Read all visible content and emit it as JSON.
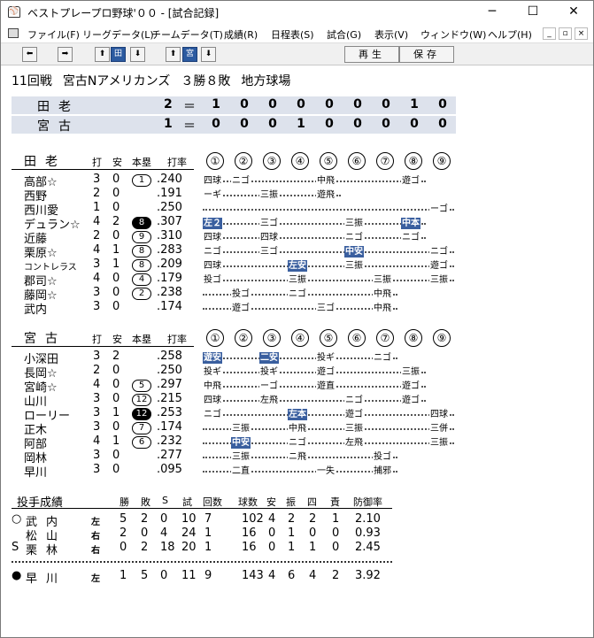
{
  "window": {
    "title": "ベストプレープロ野球'００ - [試合記録]",
    "icon": "⚾"
  },
  "window_buttons": {
    "minimize": "─",
    "maximize": "☐",
    "close": "✕"
  },
  "menu": [
    "ファイル(F)",
    "リーグデータ(L)",
    "チームデータ(T)",
    "成績(R)",
    "日程表(S)",
    "試合(G)",
    "表示(V)",
    "ウィンドウ(W)",
    "ヘルプ(H)"
  ],
  "mdi_buttons": [
    "_",
    "▫",
    "×"
  ],
  "toolbar": {
    "left": "⬅",
    "right": "➡",
    "up1": "⬆",
    "team1": "田",
    "down1": "⬇",
    "up2": "⬆",
    "team2": "宮",
    "down2": "⬇",
    "replay": "再生",
    "save": "保存"
  },
  "game_info": {
    "round": "11回戦",
    "opponent": "宮古Nアメリカンズ",
    "record": "３勝８敗",
    "venue": "地方球場"
  },
  "scoreboard": [
    {
      "team": "田老",
      "total": "2",
      "eq": "＝",
      "innings": [
        "1",
        "0",
        "0",
        "0",
        "0",
        "0",
        "0",
        "1",
        "0"
      ]
    },
    {
      "team": "宮古",
      "total": "1",
      "eq": "＝",
      "innings": [
        "0",
        "0",
        "0",
        "1",
        "0",
        "0",
        "0",
        "0",
        "0"
      ]
    }
  ],
  "batting_headers": {
    "ab": "打",
    "h": "安",
    "hr": "本塁",
    "avg": "打率",
    "innings": [
      "①",
      "②",
      "③",
      "④",
      "⑤",
      "⑥",
      "⑦",
      "⑧",
      "⑨"
    ]
  },
  "teams": [
    {
      "name": "田老",
      "rows": [
        {
          "n": "高部☆",
          "ab": "3",
          "h": "0",
          "hr": "1",
          "hrf": false,
          "avg": ".240",
          "abs": [
            [
              0,
              "四球",
              false
            ],
            [
              1,
              "ニゴ",
              false
            ],
            [
              4,
              "中飛",
              false
            ],
            [
              7,
              "遊ゴ",
              false
            ]
          ]
        },
        {
          "n": "西野",
          "ab": "2",
          "h": "0",
          "hr": "",
          "avg": ".191",
          "abs": [
            [
              0,
              "ーギ",
              false
            ],
            [
              2,
              "三振",
              false
            ],
            [
              4,
              "遊飛",
              false
            ]
          ]
        },
        {
          "n": "西川愛",
          "ab": "1",
          "h": "0",
          "hr": "",
          "avg": ".250",
          "abs": [
            [
              8,
              "ーゴ",
              false
            ]
          ]
        },
        {
          "n": "デュラン☆",
          "ab": "4",
          "h": "2",
          "hr": "8",
          "hrf": true,
          "avg": ".307",
          "abs": [
            [
              0,
              "左２",
              true
            ],
            [
              2,
              "三ゴ",
              false
            ],
            [
              5,
              "三振",
              false
            ],
            [
              7,
              "中本",
              true
            ]
          ]
        },
        {
          "n": "近藤",
          "ab": "2",
          "h": "0",
          "hr": "9",
          "hrf": false,
          "avg": ".310",
          "abs": [
            [
              0,
              "四球",
              false
            ],
            [
              2,
              "四球",
              false
            ],
            [
              5,
              "ニゴ",
              false
            ],
            [
              7,
              "ニゴ",
              false
            ]
          ]
        },
        {
          "n": "栗原☆",
          "ab": "4",
          "h": "1",
          "hr": "8",
          "hrf": false,
          "avg": ".283",
          "abs": [
            [
              0,
              "ニゴ",
              false
            ],
            [
              2,
              "三ゴ",
              false
            ],
            [
              5,
              "中安",
              true
            ],
            [
              8,
              "ニゴ",
              false
            ]
          ]
        },
        {
          "n": "コントレラス",
          "ab": "3",
          "h": "1",
          "hr": "8",
          "hrf": false,
          "avg": ".209",
          "abs": [
            [
              0,
              "四球",
              false
            ],
            [
              3,
              "左安",
              true
            ],
            [
              5,
              "三振",
              false
            ],
            [
              8,
              "遊ゴ",
              false
            ]
          ]
        },
        {
          "n": "郡司☆",
          "ab": "4",
          "h": "0",
          "hr": "4",
          "hrf": false,
          "avg": ".179",
          "abs": [
            [
              0,
              "投ゴ",
              false
            ],
            [
              3,
              "三振",
              false
            ],
            [
              6,
              "三振",
              false
            ],
            [
              8,
              "三振",
              false
            ]
          ]
        },
        {
          "n": "藤岡☆",
          "ab": "3",
          "h": "0",
          "hr": "2",
          "hrf": false,
          "avg": ".238",
          "abs": [
            [
              1,
              "投ゴ",
              false
            ],
            [
              3,
              "ニゴ",
              false
            ],
            [
              6,
              "中飛",
              false
            ]
          ]
        },
        {
          "n": "武内",
          "ab": "3",
          "h": "0",
          "hr": "",
          "avg": ".174",
          "abs": [
            [
              1,
              "遊ゴ",
              false
            ],
            [
              4,
              "三ゴ",
              false
            ],
            [
              6,
              "中飛",
              false
            ]
          ]
        }
      ]
    },
    {
      "name": "宮古",
      "rows": [
        {
          "n": "小深田",
          "ab": "3",
          "h": "2",
          "hr": "",
          "avg": ".258",
          "abs": [
            [
              0,
              "遊安",
              true
            ],
            [
              2,
              "二安",
              true
            ],
            [
              4,
              "投ギ",
              false
            ],
            [
              6,
              "ニゴ",
              false
            ]
          ]
        },
        {
          "n": "長岡☆",
          "ab": "2",
          "h": "0",
          "hr": "",
          "avg": ".250",
          "abs": [
            [
              0,
              "投ギ",
              false
            ],
            [
              2,
              "投ギ",
              false
            ],
            [
              4,
              "遊ゴ",
              false
            ],
            [
              7,
              "三振",
              false
            ]
          ]
        },
        {
          "n": "宮崎☆",
          "ab": "4",
          "h": "0",
          "hr": "5",
          "hrf": false,
          "avg": ".297",
          "abs": [
            [
              0,
              "中飛",
              false
            ],
            [
              2,
              "ーゴ",
              false
            ],
            [
              4,
              "遊直",
              false
            ],
            [
              7,
              "遊ゴ",
              false
            ]
          ]
        },
        {
          "n": "山川",
          "ab": "3",
          "h": "0",
          "hr": "12",
          "hrf": false,
          "avg": ".215",
          "abs": [
            [
              0,
              "四球",
              false
            ],
            [
              2,
              "左飛",
              false
            ],
            [
              5,
              "ニゴ",
              false
            ],
            [
              7,
              "遊ゴ",
              false
            ]
          ]
        },
        {
          "n": "ローリー",
          "ab": "3",
          "h": "1",
          "hr": "12",
          "hrf": true,
          "avg": ".253",
          "abs": [
            [
              0,
              "ニゴ",
              false
            ],
            [
              3,
              "左本",
              true
            ],
            [
              5,
              "遊ゴ",
              false
            ],
            [
              8,
              "四球",
              false
            ]
          ]
        },
        {
          "n": "正木",
          "ab": "3",
          "h": "0",
          "hr": "7",
          "hrf": false,
          "avg": ".174",
          "abs": [
            [
              1,
              "三振",
              false
            ],
            [
              3,
              "中飛",
              false
            ],
            [
              5,
              "三振",
              false
            ],
            [
              8,
              "三併",
              false
            ]
          ]
        },
        {
          "n": "阿部",
          "ab": "4",
          "h": "1",
          "hr": "6",
          "hrf": false,
          "avg": ".232",
          "abs": [
            [
              1,
              "中安",
              true
            ],
            [
              3,
              "ニゴ",
              false
            ],
            [
              5,
              "左飛",
              false
            ],
            [
              8,
              "三振",
              false
            ]
          ]
        },
        {
          "n": "岡林",
          "ab": "3",
          "h": "0",
          "hr": "",
          "avg": ".277",
          "abs": [
            [
              1,
              "三振",
              false
            ],
            [
              3,
              "ニ飛",
              false
            ],
            [
              6,
              "投ゴ",
              false
            ]
          ]
        },
        {
          "n": "早川",
          "ab": "3",
          "h": "0",
          "hr": "",
          "avg": ".095",
          "abs": [
            [
              1,
              "二直",
              false
            ],
            [
              4,
              "一失",
              false
            ],
            [
              6,
              "捕邪",
              false
            ]
          ]
        }
      ]
    }
  ],
  "pitching": {
    "title": "投手成績",
    "headers": [
      "勝",
      "敗",
      "S",
      "試",
      "回数",
      "球数",
      "安",
      "振",
      "四",
      "責",
      "防御率"
    ],
    "rows": [
      {
        "mark": "○",
        "name": "武内",
        "hand": "左",
        "w": "5",
        "l": "2",
        "s": "0",
        "g": "10",
        "ip": "7",
        "pc": "102",
        "h": "4",
        "k": "2",
        "bb": "2",
        "er": "1",
        "era": "2.10"
      },
      {
        "mark": "",
        "name": "松山",
        "hand": "右",
        "w": "2",
        "l": "0",
        "s": "4",
        "g": "24",
        "ip": "1",
        "pc": "16",
        "h": "0",
        "k": "1",
        "bb": "0",
        "er": "0",
        "era": "0.93"
      },
      {
        "mark": "S",
        "name": "栗林",
        "hand": "右",
        "w": "0",
        "l": "2",
        "s": "18",
        "g": "20",
        "ip": "1",
        "pc": "16",
        "h": "0",
        "k": "1",
        "bb": "1",
        "er": "0",
        "era": "2.45"
      },
      {
        "mark": "●",
        "name": "早川",
        "hand": "左",
        "w": "1",
        "l": "5",
        "s": "0",
        "g": "11",
        "ip": "9",
        "pc": "143",
        "h": "4",
        "k": "6",
        "bb": "4",
        "er": "2",
        "era": "3.92"
      }
    ]
  }
}
